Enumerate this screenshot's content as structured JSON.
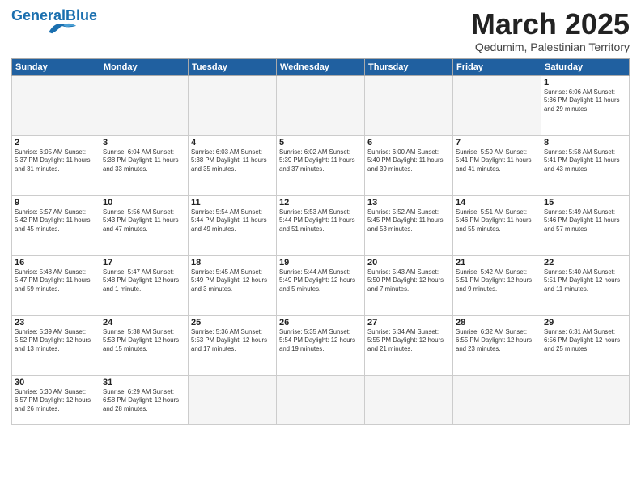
{
  "header": {
    "logo_general": "General",
    "logo_blue": "Blue",
    "month": "March 2025",
    "location": "Qedumim, Palestinian Territory"
  },
  "days_of_week": [
    "Sunday",
    "Monday",
    "Tuesday",
    "Wednesday",
    "Thursday",
    "Friday",
    "Saturday"
  ],
  "weeks": [
    [
      {
        "num": "",
        "info": "",
        "empty": true
      },
      {
        "num": "",
        "info": "",
        "empty": true
      },
      {
        "num": "",
        "info": "",
        "empty": true
      },
      {
        "num": "",
        "info": "",
        "empty": true
      },
      {
        "num": "",
        "info": "",
        "empty": true
      },
      {
        "num": "",
        "info": "",
        "empty": true
      },
      {
        "num": "1",
        "info": "Sunrise: 6:06 AM\nSunset: 5:36 PM\nDaylight: 11 hours\nand 29 minutes."
      }
    ],
    [
      {
        "num": "2",
        "info": "Sunrise: 6:05 AM\nSunset: 5:37 PM\nDaylight: 11 hours\nand 31 minutes."
      },
      {
        "num": "3",
        "info": "Sunrise: 6:04 AM\nSunset: 5:38 PM\nDaylight: 11 hours\nand 33 minutes."
      },
      {
        "num": "4",
        "info": "Sunrise: 6:03 AM\nSunset: 5:38 PM\nDaylight: 11 hours\nand 35 minutes."
      },
      {
        "num": "5",
        "info": "Sunrise: 6:02 AM\nSunset: 5:39 PM\nDaylight: 11 hours\nand 37 minutes."
      },
      {
        "num": "6",
        "info": "Sunrise: 6:00 AM\nSunset: 5:40 PM\nDaylight: 11 hours\nand 39 minutes."
      },
      {
        "num": "7",
        "info": "Sunrise: 5:59 AM\nSunset: 5:41 PM\nDaylight: 11 hours\nand 41 minutes."
      },
      {
        "num": "8",
        "info": "Sunrise: 5:58 AM\nSunset: 5:41 PM\nDaylight: 11 hours\nand 43 minutes."
      }
    ],
    [
      {
        "num": "9",
        "info": "Sunrise: 5:57 AM\nSunset: 5:42 PM\nDaylight: 11 hours\nand 45 minutes."
      },
      {
        "num": "10",
        "info": "Sunrise: 5:56 AM\nSunset: 5:43 PM\nDaylight: 11 hours\nand 47 minutes."
      },
      {
        "num": "11",
        "info": "Sunrise: 5:54 AM\nSunset: 5:44 PM\nDaylight: 11 hours\nand 49 minutes."
      },
      {
        "num": "12",
        "info": "Sunrise: 5:53 AM\nSunset: 5:44 PM\nDaylight: 11 hours\nand 51 minutes."
      },
      {
        "num": "13",
        "info": "Sunrise: 5:52 AM\nSunset: 5:45 PM\nDaylight: 11 hours\nand 53 minutes."
      },
      {
        "num": "14",
        "info": "Sunrise: 5:51 AM\nSunset: 5:46 PM\nDaylight: 11 hours\nand 55 minutes."
      },
      {
        "num": "15",
        "info": "Sunrise: 5:49 AM\nSunset: 5:46 PM\nDaylight: 11 hours\nand 57 minutes."
      }
    ],
    [
      {
        "num": "16",
        "info": "Sunrise: 5:48 AM\nSunset: 5:47 PM\nDaylight: 11 hours\nand 59 minutes."
      },
      {
        "num": "17",
        "info": "Sunrise: 5:47 AM\nSunset: 5:48 PM\nDaylight: 12 hours\nand 1 minute."
      },
      {
        "num": "18",
        "info": "Sunrise: 5:45 AM\nSunset: 5:49 PM\nDaylight: 12 hours\nand 3 minutes."
      },
      {
        "num": "19",
        "info": "Sunrise: 5:44 AM\nSunset: 5:49 PM\nDaylight: 12 hours\nand 5 minutes."
      },
      {
        "num": "20",
        "info": "Sunrise: 5:43 AM\nSunset: 5:50 PM\nDaylight: 12 hours\nand 7 minutes."
      },
      {
        "num": "21",
        "info": "Sunrise: 5:42 AM\nSunset: 5:51 PM\nDaylight: 12 hours\nand 9 minutes."
      },
      {
        "num": "22",
        "info": "Sunrise: 5:40 AM\nSunset: 5:51 PM\nDaylight: 12 hours\nand 11 minutes."
      }
    ],
    [
      {
        "num": "23",
        "info": "Sunrise: 5:39 AM\nSunset: 5:52 PM\nDaylight: 12 hours\nand 13 minutes."
      },
      {
        "num": "24",
        "info": "Sunrise: 5:38 AM\nSunset: 5:53 PM\nDaylight: 12 hours\nand 15 minutes."
      },
      {
        "num": "25",
        "info": "Sunrise: 5:36 AM\nSunset: 5:53 PM\nDaylight: 12 hours\nand 17 minutes."
      },
      {
        "num": "26",
        "info": "Sunrise: 5:35 AM\nSunset: 5:54 PM\nDaylight: 12 hours\nand 19 minutes."
      },
      {
        "num": "27",
        "info": "Sunrise: 5:34 AM\nSunset: 5:55 PM\nDaylight: 12 hours\nand 21 minutes."
      },
      {
        "num": "28",
        "info": "Sunrise: 6:32 AM\nSunset: 6:55 PM\nDaylight: 12 hours\nand 23 minutes."
      },
      {
        "num": "29",
        "info": "Sunrise: 6:31 AM\nSunset: 6:56 PM\nDaylight: 12 hours\nand 25 minutes."
      }
    ],
    [
      {
        "num": "30",
        "info": "Sunrise: 6:30 AM\nSunset: 6:57 PM\nDaylight: 12 hours\nand 26 minutes."
      },
      {
        "num": "31",
        "info": "Sunrise: 6:29 AM\nSunset: 6:58 PM\nDaylight: 12 hours\nand 28 minutes."
      },
      {
        "num": "",
        "info": "",
        "empty": true
      },
      {
        "num": "",
        "info": "",
        "empty": true
      },
      {
        "num": "",
        "info": "",
        "empty": true
      },
      {
        "num": "",
        "info": "",
        "empty": true
      },
      {
        "num": "",
        "info": "",
        "empty": true
      }
    ]
  ]
}
